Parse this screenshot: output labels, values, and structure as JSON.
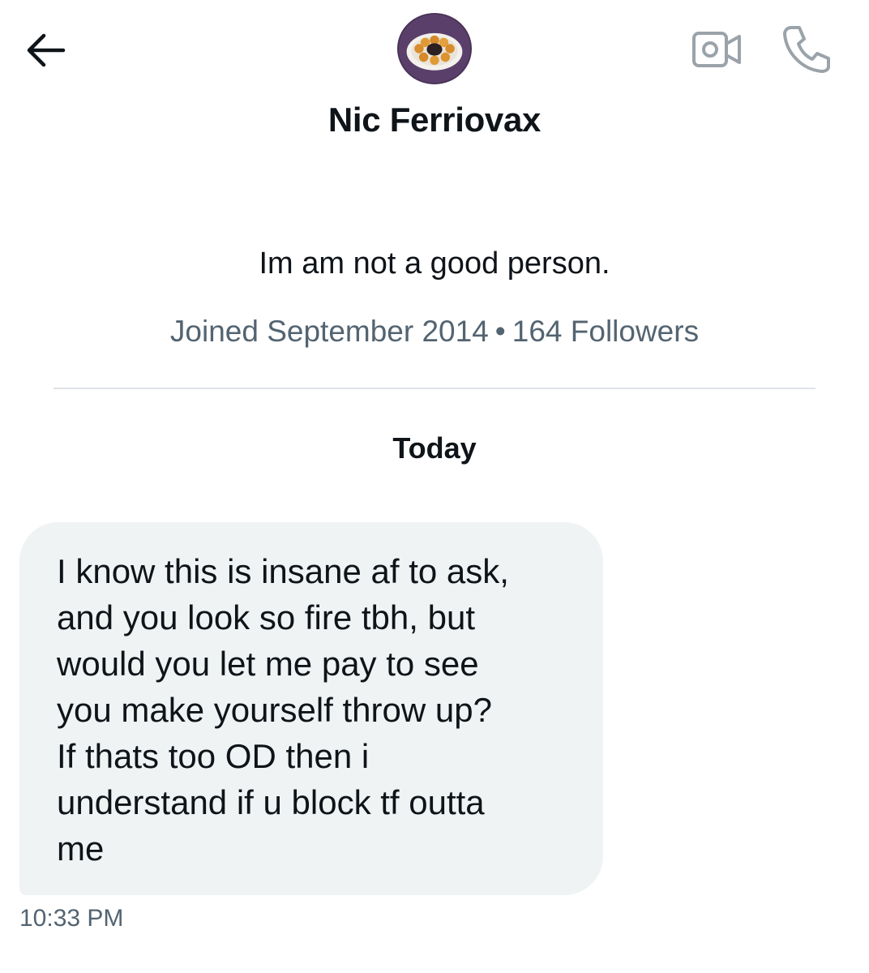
{
  "header": {
    "back_icon": "arrow-left-icon",
    "video_icon": "video-camera-icon",
    "call_icon": "phone-icon",
    "avatar_icon": "profile-avatar"
  },
  "profile": {
    "name": "Nic Ferriovax",
    "bio": "Im am not a good person.",
    "joined": "Joined September 2014",
    "separator": "•",
    "followers": "164 Followers"
  },
  "conversation": {
    "date_label": "Today",
    "messages": [
      {
        "text": "I know this is insane af to ask,\nand you look so fire tbh, but\nwould you let me pay to see\nyou make yourself throw up?\nIf thats too OD then i\nunderstand if u block tf outta\nme",
        "time": "10:33 PM"
      }
    ]
  },
  "colors": {
    "text_primary": "#0f1419",
    "text_secondary": "#536471",
    "bubble_bg": "#eff3f4",
    "divider": "#dfe3e6"
  }
}
